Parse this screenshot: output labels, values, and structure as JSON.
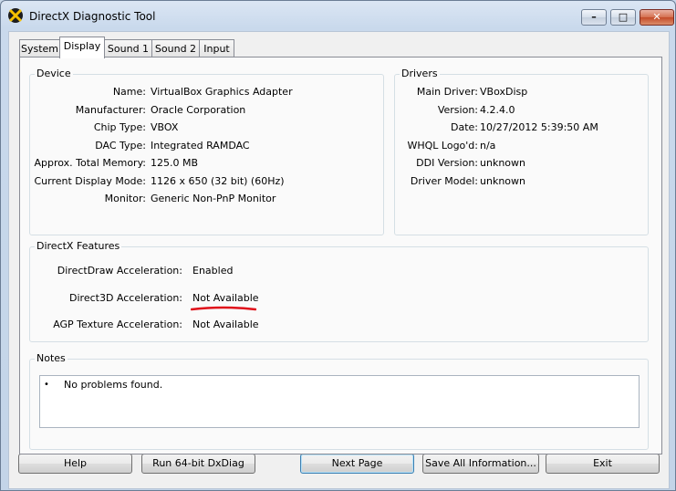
{
  "window": {
    "title": "DirectX Diagnostic Tool"
  },
  "tabs": [
    {
      "label": "System"
    },
    {
      "label": "Display"
    },
    {
      "label": "Sound 1"
    },
    {
      "label": "Sound 2"
    },
    {
      "label": "Input"
    }
  ],
  "active_tab": "Display",
  "device": {
    "title": "Device",
    "rows": [
      {
        "label": "Name:",
        "value": "VirtualBox Graphics Adapter"
      },
      {
        "label": "Manufacturer:",
        "value": "Oracle Corporation"
      },
      {
        "label": "Chip Type:",
        "value": "VBOX"
      },
      {
        "label": "DAC Type:",
        "value": "Integrated RAMDAC"
      },
      {
        "label": "Approx. Total Memory:",
        "value": "125.0 MB"
      },
      {
        "label": "Current Display Mode:",
        "value": "1126 x 650 (32 bit) (60Hz)"
      },
      {
        "label": "Monitor:",
        "value": "Generic Non-PnP Monitor"
      }
    ]
  },
  "drivers": {
    "title": "Drivers",
    "rows": [
      {
        "label": "Main Driver:",
        "value": "VBoxDisp"
      },
      {
        "label": "Version:",
        "value": "4.2.4.0"
      },
      {
        "label": "Date:",
        "value": "10/27/2012 5:39:50 AM"
      },
      {
        "label": "WHQL Logo'd:",
        "value": "n/a"
      },
      {
        "label": "DDI Version:",
        "value": "unknown"
      },
      {
        "label": "Driver Model:",
        "value": "unknown"
      }
    ]
  },
  "features": {
    "title": "DirectX Features",
    "rows": [
      {
        "label": "DirectDraw Acceleration:",
        "value": "Enabled"
      },
      {
        "label": "Direct3D Acceleration:",
        "value": "Not Available"
      },
      {
        "label": "AGP Texture Acceleration:",
        "value": "Not Available"
      }
    ]
  },
  "notes": {
    "title": "Notes",
    "bullet": "•",
    "items": [
      "No problems found."
    ]
  },
  "buttons": {
    "help": "Help",
    "run64": "Run 64-bit DxDiag",
    "next_page": "Next Page",
    "save_all": "Save All Information...",
    "exit": "Exit"
  },
  "colors": {
    "annotation_red": "#e0101a"
  }
}
